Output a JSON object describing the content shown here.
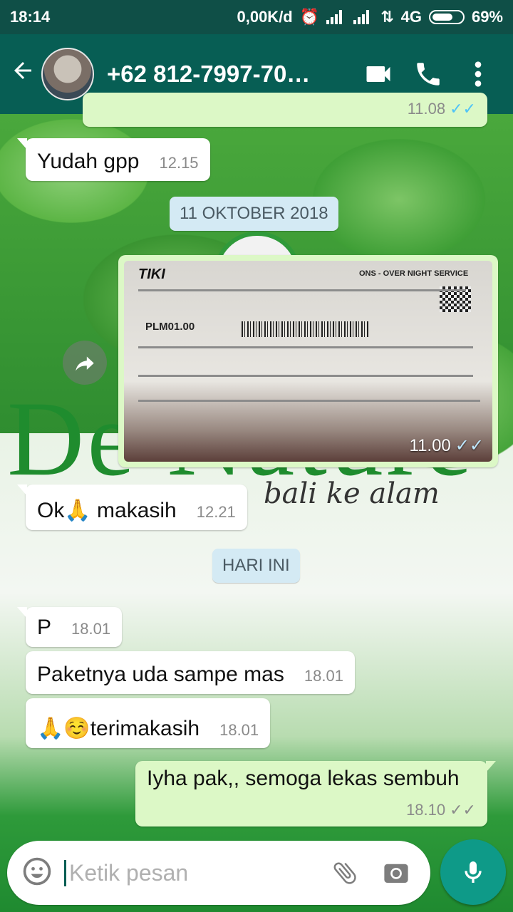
{
  "status_bar": {
    "time": "18:14",
    "speed": "0,00K/d",
    "network": "4G",
    "battery": "69%"
  },
  "header": {
    "contact": "+62 812-7997-70…"
  },
  "chat": {
    "top_partial_time": "11.08",
    "messages": [
      {
        "text": "Yudah gpp",
        "time": "12.15"
      },
      {
        "text": "Ok🙏 makasih",
        "time": "12.21"
      },
      {
        "text": "P",
        "time": "18.01"
      },
      {
        "text": "Paketnya uda sampe mas",
        "time": "18.01"
      },
      {
        "text": "🙏☺️terimakasih",
        "time": "18.01"
      },
      {
        "text": "Iyha pak,, semoga lekas sembuh",
        "time": "18.10"
      }
    ],
    "date_1": "11 OKTOBER 2018",
    "date_2": "HARI INI",
    "image_time": "11.00",
    "receipt": {
      "logo": "TIKI",
      "service": "ONS - OVER NIGHT SERVICE",
      "code": "PLM01.00"
    }
  },
  "wallpaper": {
    "brand": "De Nature",
    "tagline": "bali ke alam"
  },
  "composer": {
    "placeholder": "Ketik pesan"
  },
  "colors": {
    "header": "#075e54",
    "statusbar": "#0f4f47",
    "outgoing": "#dcf8c6",
    "mic": "#0e9a88"
  }
}
